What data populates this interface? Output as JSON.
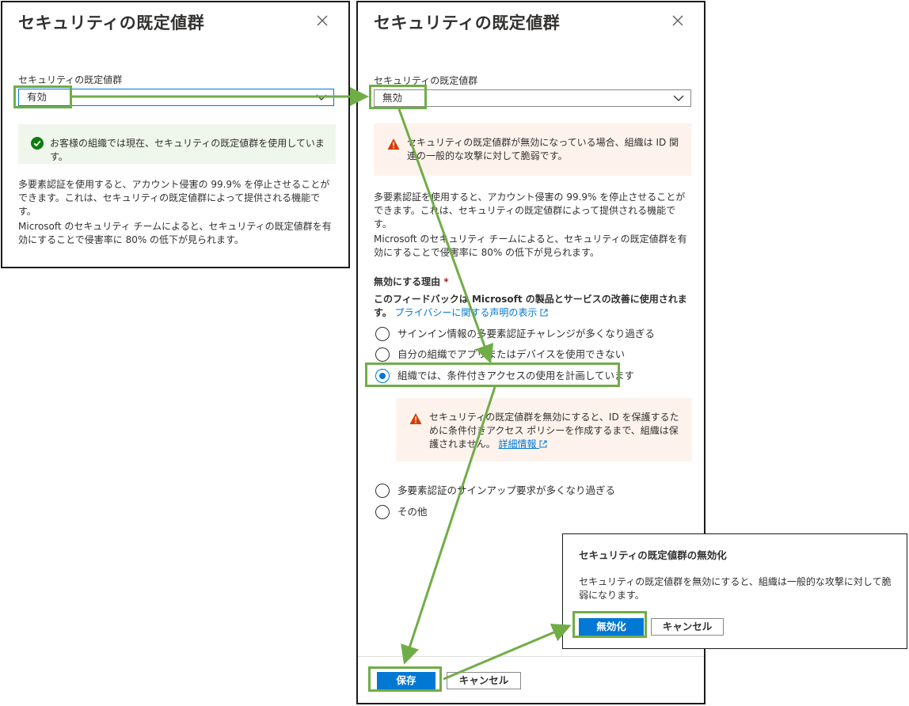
{
  "left_panel": {
    "title": "セキュリティの既定値群",
    "field_label": "セキュリティの既定値群",
    "dropdown_value": "有効",
    "success_text": "お客様の組織では現在、セキュリティの既定値群を使用しています。",
    "para1": "多要素認証を使用すると、アカウント侵害の 99.9% を停止させることができます。これは、セキュリティの既定値群によって提供される機能です。",
    "para2": "Microsoft のセキュリティ チームによると、セキュリティの既定値群を有効にすることで侵害率に 80% の低下が見られます。"
  },
  "right_panel": {
    "title": "セキュリティの既定値群",
    "field_label": "セキュリティの既定値群",
    "dropdown_value": "無効",
    "warning_text": "セキュリティの既定値群が無効になっている場合、組織は ID 関連の一般的な攻撃に対して脆弱です。",
    "para1": "多要素認証を使用すると、アカウント侵害の 99.9% を停止させることができます。これは、セキュリティの既定値群によって提供される機能です。",
    "para2": "Microsoft のセキュリティ チームによると、セキュリティの既定値群を有効にすることで侵害率に 80% の低下が見られます。",
    "reason_label": "無効にする理由",
    "required_mark": "*",
    "feedback_text": "このフィードバックは Microsoft の製品とサービスの改善に使用されます。",
    "privacy_link": "プライバシーに関する声明の表示",
    "reasons": [
      {
        "label": "サインイン情報の多要素認証チャレンジが多くなり過ぎる",
        "checked": false
      },
      {
        "label": "自分の組織でアプリまたはデバイスを使用できない",
        "checked": false
      },
      {
        "label": "組織では、条件付きアクセスの使用を計画しています",
        "checked": true
      },
      {
        "label": "多要素認証のサインアップ要求が多くなり過ぎる",
        "checked": false
      },
      {
        "label": "その他",
        "checked": false
      }
    ],
    "ca_warning_text": "セキュリティの既定値群を無効にすると、ID を保護するために条件付きアクセス ポリシーを作成するまで、組織は保護されません。",
    "ca_warning_link": "詳細情報",
    "save_label": "保存",
    "cancel_label": "キャンセル"
  },
  "dialog": {
    "title": "セキュリティの既定値群の無効化",
    "body": "セキュリティの既定値群を無効にすると、組織は一般的な攻撃に対して脆弱になります。",
    "disable_label": "無効化",
    "cancel_label": "キャンセル"
  },
  "colors": {
    "highlight": "#70ad47",
    "primary": "#0078d4",
    "success_bg": "#eff6eb",
    "warning_bg": "#fdf3ec",
    "warning_icon": "#d83b01",
    "success_icon": "#107c10"
  }
}
